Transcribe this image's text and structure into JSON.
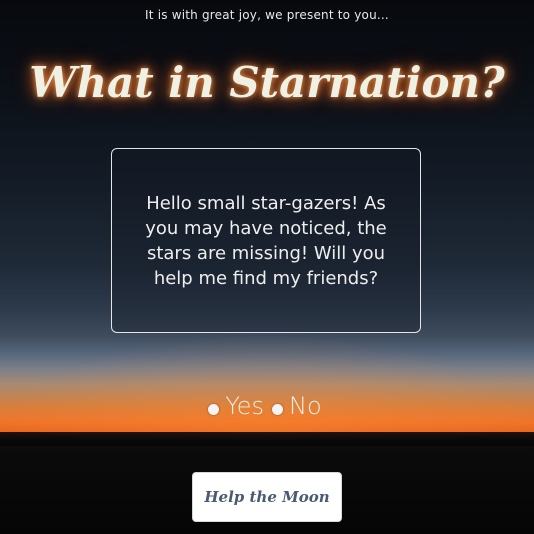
{
  "intro_text": "It is with great joy, we present to you...",
  "title": "What in Starnation?",
  "message": "Hello small star-gazers! As you may have noticed, the stars are missing! Will you help me find my friends?",
  "choices": [
    {
      "label": "Yes"
    },
    {
      "label": "No"
    }
  ],
  "button_label": "Help the Moon",
  "colors": {
    "title_glow": "#ff8a3c",
    "title_text": "#eef1e3",
    "button_text": "#4a5a70",
    "sunset": "#f0752a"
  }
}
